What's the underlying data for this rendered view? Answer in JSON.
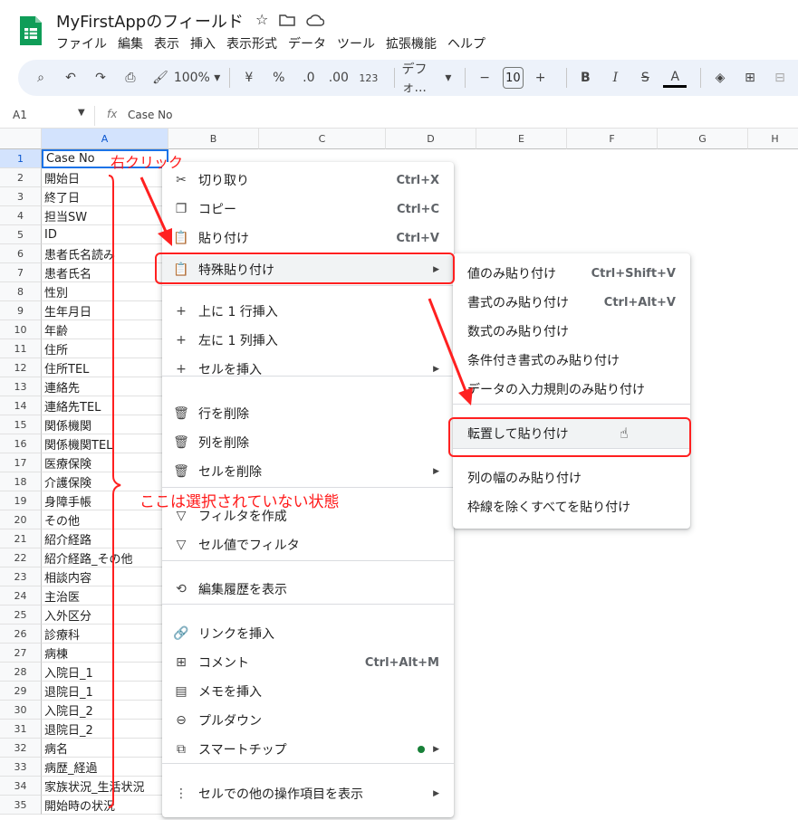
{
  "doc": {
    "title": "MyFirstAppのフィールド",
    "menus": [
      "ファイル",
      "編集",
      "表示",
      "挿入",
      "表示形式",
      "データ",
      "ツール",
      "拡張機能",
      "ヘルプ"
    ]
  },
  "toolbar": {
    "zoom": "100%",
    "currency": "¥",
    "percent": "%",
    "dec_down": ".0",
    "dec_up": ".00",
    "number_fmt": "123",
    "font": "デフォ...",
    "font_size": "10",
    "bold": "B",
    "italic": "I",
    "strike": "S",
    "textcolor": "A"
  },
  "formula": {
    "cellref": "A1",
    "fx": "fx",
    "value": "Case No"
  },
  "columns": [
    "A",
    "B",
    "C",
    "D",
    "E",
    "F",
    "G",
    "H"
  ],
  "rows": [
    "Case No",
    "開始日",
    "終了日",
    "担当SW",
    "ID",
    "患者氏名読み",
    "患者氏名",
    "性別",
    "生年月日",
    "年齢",
    "住所",
    "住所TEL",
    "連絡先",
    "連絡先TEL",
    "関係機関",
    "関係機関TEL",
    "医療保険",
    "介護保険",
    "身障手帳",
    "その他",
    "紹介経路",
    "紹介経路_その他",
    "相談内容",
    "主治医",
    "入外区分",
    "診療科",
    "病棟",
    "入院日_1",
    "退院日_1",
    "入院日_2",
    "退院日_2",
    "病名",
    "病歴_経過",
    "家族状況_生活状況",
    "開始時の状況"
  ],
  "row_numbers": [
    "1",
    "2",
    "3",
    "4",
    "5",
    "6",
    "7",
    "8",
    "9",
    "10",
    "11",
    "12",
    "13",
    "14",
    "15",
    "16",
    "17",
    "18",
    "19",
    "20",
    "21",
    "22",
    "23",
    "24",
    "25",
    "26",
    "27",
    "28",
    "29",
    "30",
    "31",
    "32",
    "33",
    "34",
    "35"
  ],
  "context_menu": [
    {
      "label": "切り取り",
      "shortcut": "Ctrl+X",
      "icon": "scissors-icon"
    },
    {
      "label": "コピー",
      "shortcut": "Ctrl+C",
      "icon": "copy-icon"
    },
    {
      "label": "貼り付け",
      "shortcut": "Ctrl+V",
      "icon": "paste-icon"
    },
    {
      "label": "特殊貼り付け",
      "arrow": "▶",
      "icon": "paste-special-icon"
    },
    {
      "label": "上に 1 行挿入",
      "icon": "plus-icon"
    },
    {
      "label": "左に 1 列挿入",
      "icon": "plus-icon"
    },
    {
      "label": "セルを挿入",
      "arrow": "▶",
      "icon": "plus-icon"
    },
    {
      "label": "行を削除",
      "icon": "trash-icon"
    },
    {
      "label": "列を削除",
      "icon": "trash-icon"
    },
    {
      "label": "セルを削除",
      "arrow": "▶",
      "icon": "trash-icon"
    },
    {
      "label": "フィルタを作成",
      "icon": "filter-icon"
    },
    {
      "label": "セル値でフィルタ",
      "icon": "filter-icon"
    },
    {
      "label": "編集履歴を表示",
      "icon": "history-icon"
    },
    {
      "label": "リンクを挿入",
      "icon": "link-icon"
    },
    {
      "label": "コメント",
      "shortcut": "Ctrl+Alt+M",
      "icon": "comment-icon"
    },
    {
      "label": "メモを挿入",
      "icon": "note-icon"
    },
    {
      "label": "プルダウン",
      "icon": "dropdown-icon"
    },
    {
      "label": "スマートチップ",
      "arrow": "▶",
      "icon": "smartchip-icon"
    },
    {
      "label": "セルでの他の操作項目を表示",
      "arrow": "▶",
      "icon": "more-vert-icon"
    }
  ],
  "submenu": [
    {
      "label": "値のみ貼り付け",
      "shortcut": "Ctrl+Shift+V"
    },
    {
      "label": "書式のみ貼り付け",
      "shortcut": "Ctrl+Alt+V"
    },
    {
      "label": "数式のみ貼り付け"
    },
    {
      "label": "条件付き書式のみ貼り付け"
    },
    {
      "label": "データの入力規則のみ貼り付け"
    },
    {
      "label": "転置して貼り付け"
    },
    {
      "label": "列の幅のみ貼り付け"
    },
    {
      "label": "枠線を除くすべてを貼り付け"
    }
  ],
  "annotations": {
    "right_click": "右クリック",
    "not_selected": "ここは選択されていない状態"
  },
  "colors": {
    "accent": "#ff1a1a",
    "sheets_green": "#0f9d58",
    "smartchip_dot": "#188038"
  }
}
